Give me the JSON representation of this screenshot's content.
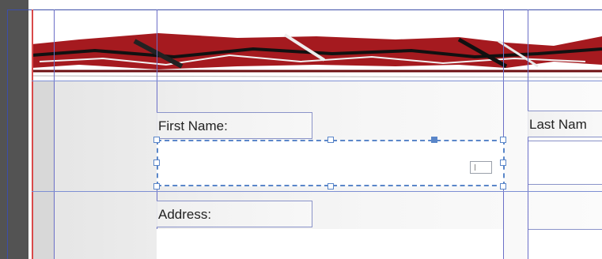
{
  "form": {
    "first_name_label": "First Name:",
    "last_name_label": "Last Nam",
    "address_label": "Address:"
  },
  "colors": {
    "guide": "#6b6fc7",
    "selection": "#5a86c9",
    "banner_red": "#a51a1f"
  },
  "icons": {
    "text_frame_port": "text-in-port-icon",
    "selection_handle": "square-handle"
  }
}
